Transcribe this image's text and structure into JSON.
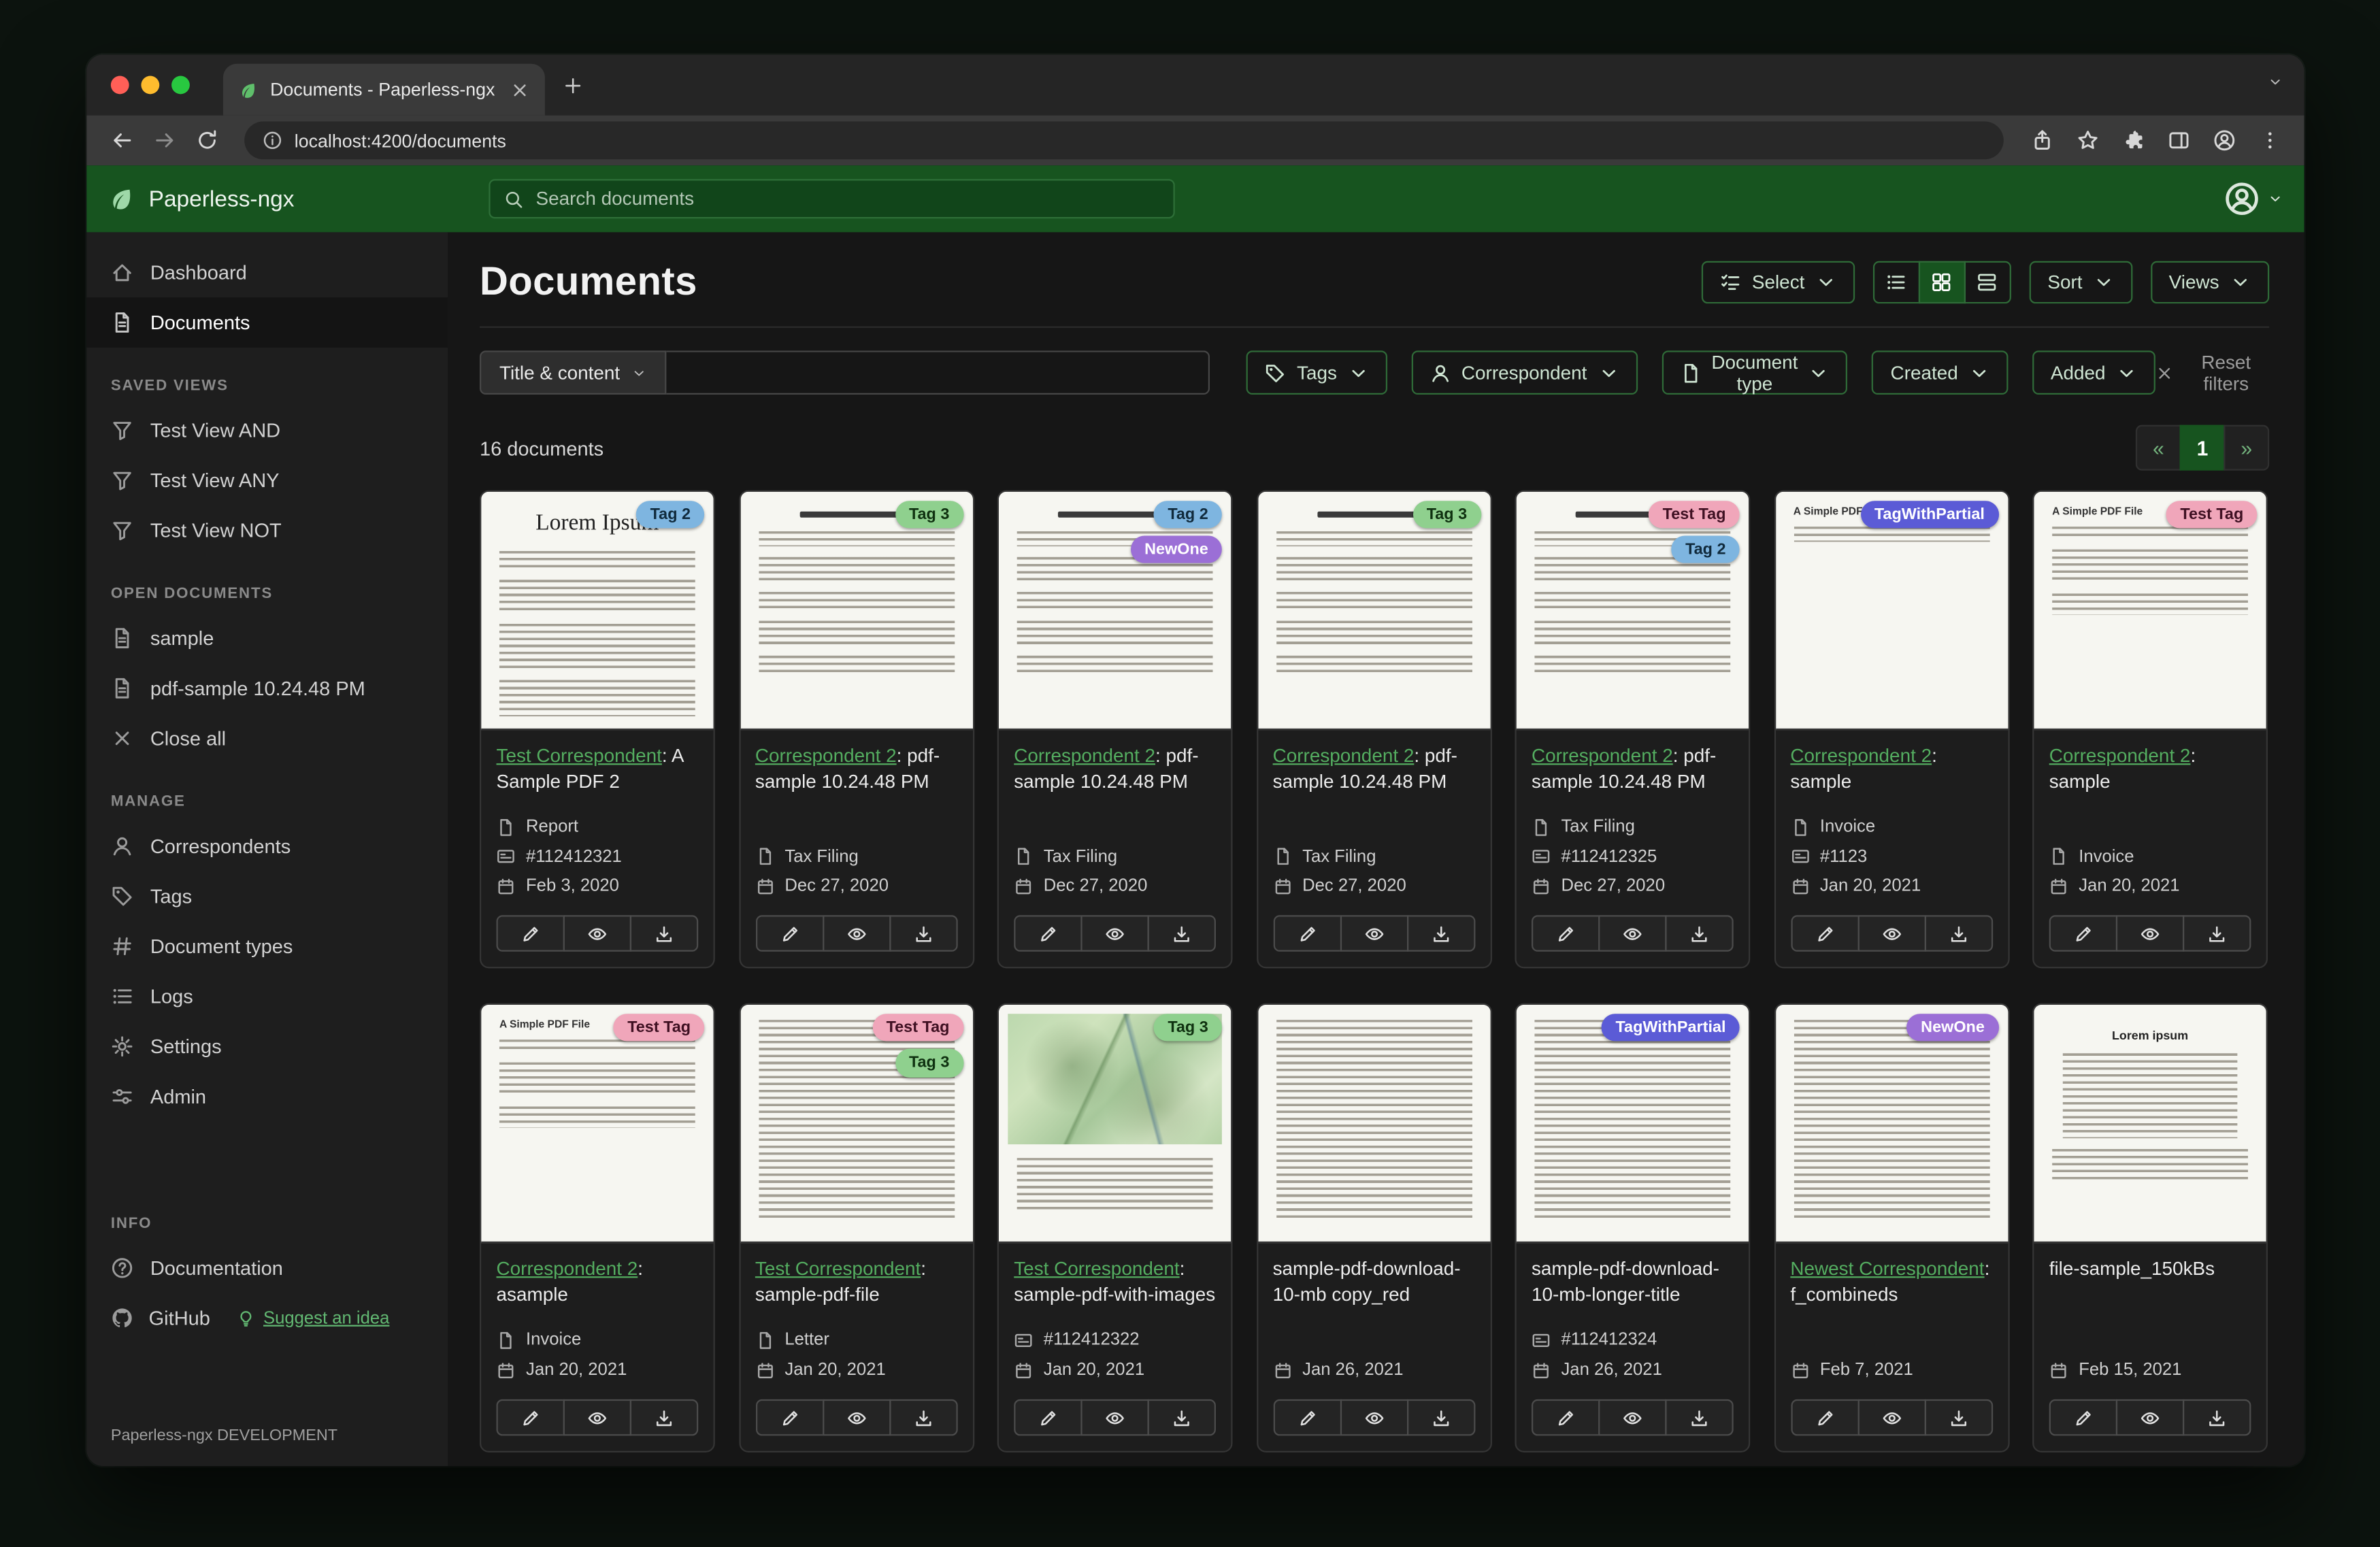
{
  "browser": {
    "tab": {
      "title": "Documents - Paperless-ngx"
    },
    "url": "localhost:4200/documents",
    "nav_icons": [
      "back",
      "forward",
      "reload"
    ],
    "action_icons": [
      "share",
      "star",
      "puzzle",
      "panel",
      "avatar",
      "kebab"
    ]
  },
  "app_header": {
    "brand": "Paperless-ngx",
    "search_placeholder": "Search documents"
  },
  "sidebar": {
    "primary": [
      {
        "label": "Dashboard",
        "icon": "house",
        "active": false
      },
      {
        "label": "Documents",
        "icon": "filetext",
        "active": true
      }
    ],
    "sections": [
      {
        "heading": "SAVED VIEWS",
        "items": [
          {
            "label": "Test View AND",
            "icon": "funnel"
          },
          {
            "label": "Test View ANY",
            "icon": "funnel"
          },
          {
            "label": "Test View NOT",
            "icon": "funnel"
          }
        ]
      },
      {
        "heading": "OPEN DOCUMENTS",
        "items": [
          {
            "label": "sample",
            "icon": "filetext"
          },
          {
            "label": "pdf-sample 10.24.48 PM",
            "icon": "filetext"
          },
          {
            "label": "Close all",
            "icon": "close"
          }
        ]
      },
      {
        "heading": "MANAGE",
        "items": [
          {
            "label": "Correspondents",
            "icon": "person"
          },
          {
            "label": "Tags",
            "icon": "tag"
          },
          {
            "label": "Document types",
            "icon": "hash"
          },
          {
            "label": "Logs",
            "icon": "listul"
          },
          {
            "label": "Settings",
            "icon": "gear"
          },
          {
            "label": "Admin",
            "icon": "sliders"
          }
        ]
      },
      {
        "heading": "INFO",
        "items": [
          {
            "label": "Documentation",
            "icon": "question"
          }
        ]
      }
    ],
    "github_label": "GitHub",
    "suggest_label": "Suggest an idea",
    "footer": "Paperless-ngx DEVELOPMENT"
  },
  "main": {
    "title": "Documents",
    "toolbar": {
      "select_label": "Select",
      "view_toggles": [
        {
          "icon": "listul",
          "active": false
        },
        {
          "icon": "grid",
          "active": true
        },
        {
          "icon": "rows",
          "active": false
        }
      ],
      "sort_label": "Sort",
      "views_label": "Views"
    },
    "filter_bar": {
      "field_dropdown_label": "Title & content",
      "buttons": [
        {
          "label": "Tags",
          "icon": "tag"
        },
        {
          "label": "Correspondent",
          "icon": "person"
        },
        {
          "label": "Document type",
          "icon": "file"
        },
        {
          "label": "Created",
          "icon": ""
        },
        {
          "label": "Added",
          "icon": ""
        }
      ],
      "reset_label": "Reset filters"
    },
    "count_text": "16 documents",
    "pagination": {
      "prev": "«",
      "page": "1",
      "next": "»"
    },
    "tag_colors": {
      "Tag 2": {
        "bg": "#7eb5e0",
        "fg": "#102a3c"
      },
      "Tag 3": {
        "bg": "#8fd08e",
        "fg": "#0f3110"
      },
      "NewOne": {
        "bg": "#9b6fd6",
        "fg": "#ffffff"
      },
      "Test Tag": {
        "bg": "#f0a6ba",
        "fg": "#3f1022"
      },
      "TagWithPartial": {
        "bg": "#5b5bd6",
        "fg": "#ffffff"
      }
    },
    "cards": [
      {
        "tags": [
          "Tag 2"
        ],
        "correspondent": "Test Correspondent",
        "title": ": A Sample PDF 2",
        "type": "Report",
        "asn": "#112412321",
        "date": "Feb 3, 2020",
        "thumb": "lorem",
        "thumb_text": "Lorem Ipsum"
      },
      {
        "tags": [
          "Tag 3"
        ],
        "correspondent": "Correspondent 2",
        "title": ": pdf-sample 10.24.48 PM",
        "type": "Tax Filing",
        "asn": null,
        "date": "Dec 27, 2020",
        "thumb": "pdf",
        "thumb_text": ""
      },
      {
        "tags": [
          "Tag 2",
          "NewOne"
        ],
        "correspondent": "Correspondent 2",
        "title": ": pdf-sample 10.24.48 PM",
        "type": "Tax Filing",
        "asn": null,
        "date": "Dec 27, 2020",
        "thumb": "pdf",
        "thumb_text": ""
      },
      {
        "tags": [
          "Tag 3"
        ],
        "correspondent": "Correspondent 2",
        "title": ": pdf-sample 10.24.48 PM",
        "type": "Tax Filing",
        "asn": null,
        "date": "Dec 27, 2020",
        "thumb": "pdf",
        "thumb_text": ""
      },
      {
        "tags": [
          "Test Tag",
          "Tag 2"
        ],
        "correspondent": "Correspondent 2",
        "title": ": pdf-sample 10.24.48 PM",
        "type": "Tax Filing",
        "asn": "#112412325",
        "date": "Dec 27, 2020",
        "thumb": "pdf",
        "thumb_text": ""
      },
      {
        "tags": [
          "TagWithPartial"
        ],
        "correspondent": "Correspondent 2",
        "title": ": sample",
        "type": "Invoice",
        "asn": "#1123",
        "date": "Jan 20, 2021",
        "thumb": "sparse",
        "thumb_text": "A Simple PDF File"
      },
      {
        "tags": [
          "Test Tag"
        ],
        "correspondent": "Correspondent 2",
        "title": ": sample",
        "type": "Invoice",
        "asn": null,
        "date": "Jan 20, 2021",
        "thumb": "simple",
        "thumb_text": "A Simple PDF File"
      },
      {
        "tags": [
          "Test Tag"
        ],
        "correspondent": "Correspondent 2",
        "title": ": asample",
        "type": "Invoice",
        "asn": null,
        "date": "Jan 20, 2021",
        "thumb": "simple",
        "thumb_text": "A Simple PDF File"
      },
      {
        "tags": [
          "Test Tag",
          "Tag 3"
        ],
        "correspondent": "Test Correspondent",
        "title": ": sample-pdf-file",
        "type": "Letter",
        "asn": null,
        "date": "Jan 20, 2021",
        "thumb": "dense",
        "thumb_text": ""
      },
      {
        "tags": [
          "Tag 3"
        ],
        "correspondent": "Test Correspondent",
        "title": ": sample-pdf-with-images",
        "type": null,
        "asn": "#112412322",
        "date": "Jan 20, 2021",
        "thumb": "map",
        "thumb_text": ""
      },
      {
        "tags": [],
        "correspondent": null,
        "title": "sample-pdf-download-10-mb copy_red",
        "type": null,
        "asn": null,
        "date": "Jan 26, 2021",
        "thumb": "dense",
        "thumb_text": ""
      },
      {
        "tags": [
          "TagWithPartial"
        ],
        "correspondent": null,
        "title": "sample-pdf-download-10-mb-longer-title",
        "type": null,
        "asn": "#112412324",
        "date": "Jan 26, 2021",
        "thumb": "dense",
        "thumb_text": ""
      },
      {
        "tags": [
          "NewOne"
        ],
        "correspondent": "Newest Correspondent",
        "title": ": f_combineds",
        "type": null,
        "asn": null,
        "date": "Feb 7, 2021",
        "thumb": "dense",
        "thumb_text": ""
      },
      {
        "tags": [],
        "correspondent": null,
        "title": "file-sample_150kBs",
        "type": null,
        "asn": null,
        "date": "Feb 15, 2021",
        "thumb": "lorem2",
        "thumb_text": "Lorem ipsum"
      }
    ]
  }
}
